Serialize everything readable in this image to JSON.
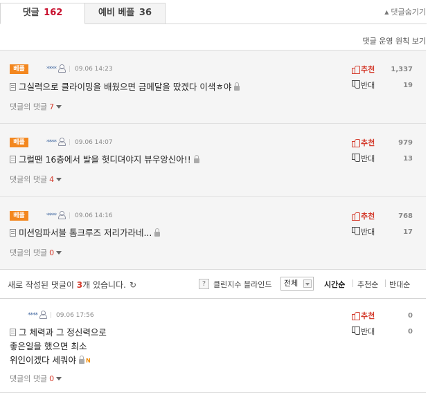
{
  "tabs": [
    {
      "label": "댓글",
      "count": "162"
    },
    {
      "label": "예비 베플",
      "count": "36"
    }
  ],
  "hide_link": "댓글숨기기",
  "policy_link": "댓글 운영 원칙 보기",
  "best_comments": [
    {
      "badge": "베플",
      "user": "****",
      "date": "09.06 14:23",
      "text": "그실력으로 클라이밍을 배웠으면 금메달을 땄겠다 이색ㅎ야",
      "replies_label": "댓글의 댓글",
      "replies": "7",
      "up_label": "추천",
      "up": "1,337",
      "down_label": "반대",
      "down": "19"
    },
    {
      "badge": "베플",
      "user": "****",
      "date": "09.06 14:07",
      "text": "그럴땐 16층에서 발을 헛디뎌야지 뷰우앙신아!!",
      "replies_label": "댓글의 댓글",
      "replies": "4",
      "up_label": "추천",
      "up": "979",
      "down_label": "반대",
      "down": "13"
    },
    {
      "badge": "베플",
      "user": "****",
      "date": "09.06 14:16",
      "text": "미션임파서블 톰크루즈 저리가라네...",
      "replies_label": "댓글의 댓글",
      "replies": "0",
      "up_label": "추천",
      "up": "768",
      "down_label": "반대",
      "down": "17"
    }
  ],
  "toolbar": {
    "new_prefix": "새로 작성된 댓글이 ",
    "new_count": "3",
    "new_suffix": "개 있습니다.",
    "help": "?",
    "clean_label": "클린지수 블라인드",
    "filter_value": "전체",
    "sort": [
      "시간순",
      "추천순",
      "반대순"
    ]
  },
  "comments": [
    {
      "user": "****",
      "date": "09.06 17:56",
      "line1": "그 체력과 그 정신력으로",
      "line2": "좋은일을 했으면 최소",
      "line3": "위인이겠다 세쿼야",
      "new_badge": "N",
      "replies_label": "댓글의 댓글",
      "replies": "0",
      "up_label": "추천",
      "up": "0",
      "down_label": "반대",
      "down": "0"
    }
  ]
}
